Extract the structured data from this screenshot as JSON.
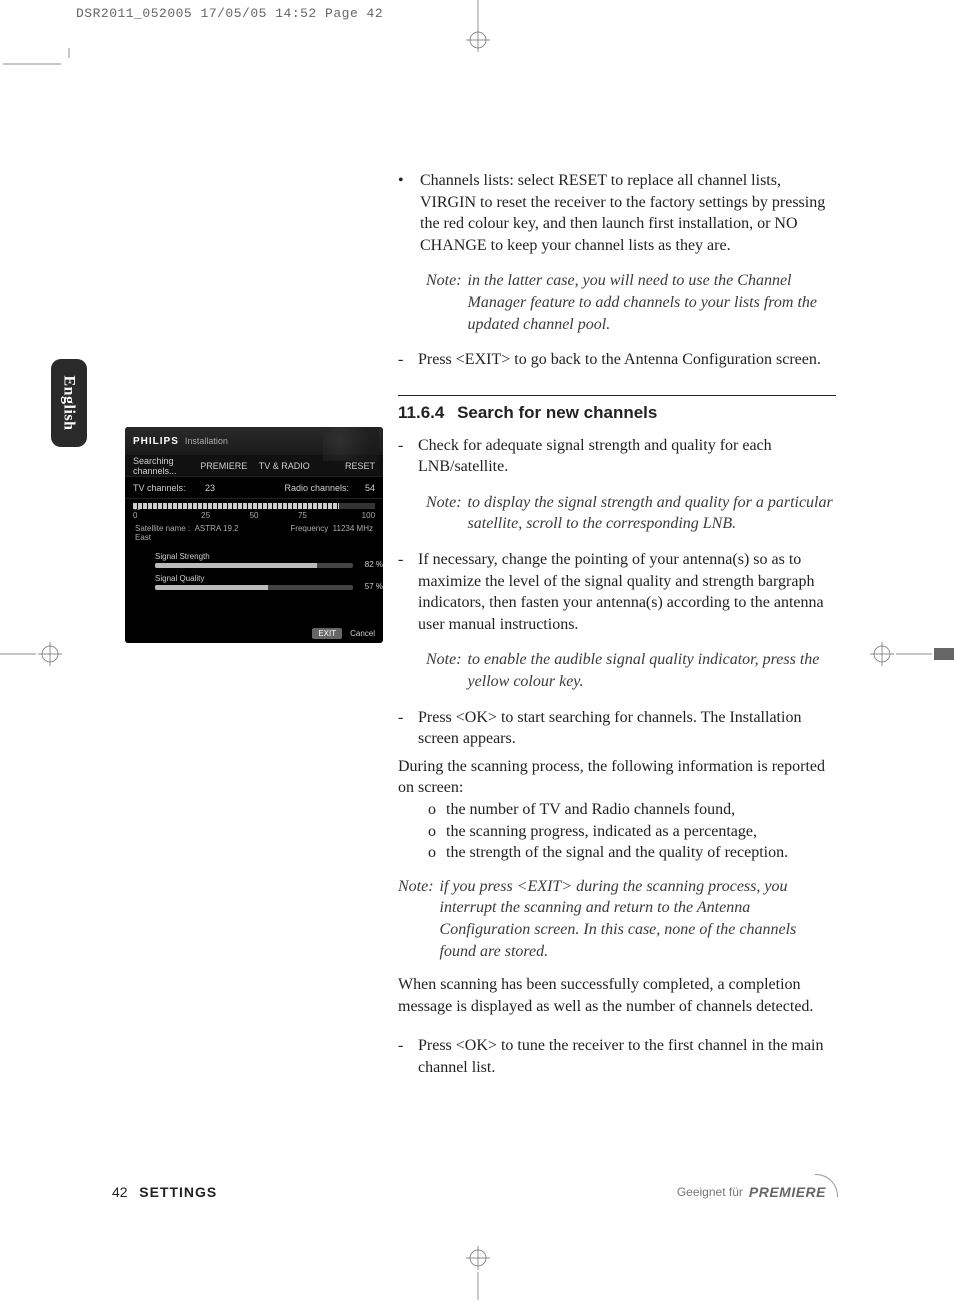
{
  "meta_header": "DSR2011_052005  17/05/05  14:52  Page 42",
  "lang_tab": "English",
  "body": {
    "p1": "Channels lists: select RESET to replace all channel lists, VIRGIN to reset the receiver to the factory settings by pressing the red colour key, and then launch first installation, or NO CHANGE to keep your channel lists as they are.",
    "note1_label": "Note:",
    "note1": "in the latter case, you will need to use the Channel Manager feature to add channels to your lists from the updated channel pool.",
    "p2": "Press <EXIT> to go back to the Antenna Configuration screen.",
    "section_num": "11.6.4",
    "section_title": "Search for new channels",
    "p3": "Check for adequate signal strength and quality for each LNB/satellite.",
    "note2_label": "Note:",
    "note2": "to display the signal strength and quality for a particular satellite, scroll to the corresponding LNB.",
    "p4": "If necessary, change the pointing of your antenna(s) so as to maximize the level of the signal quality and strength bargraph indicators, then fasten your antenna(s) according to the antenna user manual instructions.",
    "note3_label": "Note:",
    "note3": "to enable the audible signal quality indicator, press the yellow colour key.",
    "p5": "Press <OK> to start searching for channels. The Installation screen appears.",
    "p6": "During the scanning process, the following information is reported on screen:",
    "o1": "the number of TV and Radio channels found,",
    "o2": "the scanning progress, indicated as a percentage,",
    "o3": "the strength of the signal and the quality of reception.",
    "note4_label": "Note:",
    "note4": "if you press <EXIT> during the scanning process, you interrupt the scanning and return to the Antenna Configuration screen. In this case, none of the channels found are stored.",
    "p7": "When scanning has been successfully completed, a completion message is displayed as well as the number of channels detected.",
    "p8": "Press <OK> to tune the receiver to the first channel in the main channel list."
  },
  "tv": {
    "brand": "PHILIPS",
    "mode": "Installation",
    "searching": "Searching channels...",
    "premiere": "PREMIERE",
    "tvradio": "TV & RADIO",
    "reset": "RESET",
    "tvch_label": "TV channels:",
    "tvch_val": "23",
    "radio_label": "Radio channels:",
    "radio_val": "54",
    "pct_symbol": "%",
    "tick0": "0",
    "tick25": "25",
    "tick50": "50",
    "tick75": "75",
    "tick100": "100",
    "progress_pct": 85,
    "sat_label": "Satellite name :",
    "sat_val": "ASTRA 19.2 East",
    "freq_label": "Frequency",
    "freq_val": "11234 MHz",
    "strength_label": "Signal Strength",
    "strength_val": "82 %",
    "strength_pct": 82,
    "quality_label": "Signal Quality",
    "quality_val": "57 %",
    "quality_pct": 57,
    "exit": "EXIT",
    "cancel": "Cancel"
  },
  "footer": {
    "page": "42",
    "section": "SETTINGS",
    "geeignet": "Geeignet für",
    "premiere": "PREMIERE"
  }
}
